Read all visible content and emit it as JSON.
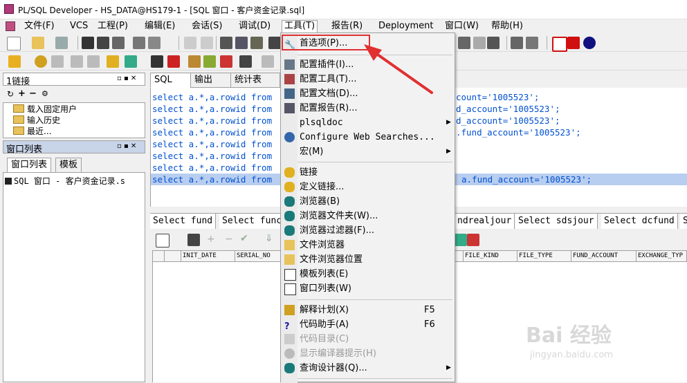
{
  "window": {
    "title": "PL/SQL Developer - HS_DATA@HS179-1 - [SQL 窗口 - 客户资金记录.sql]"
  },
  "menubar": [
    "文件(F)",
    "VCS",
    "工程(P)",
    "编辑(E)",
    "会话(S)",
    "调试(D)",
    "工具(T)",
    "报告(R)",
    "Deployment",
    "窗口(W)",
    "帮助(H)"
  ],
  "connections_panel": {
    "title": "1链接",
    "items": [
      "载入固定用户",
      "输入历史",
      "最近..."
    ]
  },
  "window_list_panel": {
    "title": "窗口列表",
    "tabs": [
      "窗口列表",
      "模板"
    ],
    "item": "SQL 窗口 - 客户资金记录.s"
  },
  "editor_tabs": [
    "SQL",
    "输出",
    "统计表"
  ],
  "code": {
    "prefix": "select a.*,a.rowid from",
    "tails": [
      "count='1005523';",
      "d_account='1005523';",
      "d_account='1005523';",
      ".fund_account='1005523';",
      "",
      "",
      "",
      "a.fund_account='1005523';"
    ]
  },
  "result_tabs": [
    "Select fund",
    "Select func",
    "ndrealjour",
    "Select sdsjour",
    "Select dcfund",
    "S"
  ],
  "grid_columns": [
    "INIT_DATE",
    "SERIAL_NO",
    "FILE_KIND",
    "FILE_TYPE",
    "FUND_ACCOUNT",
    "EXCHANGE_TYP"
  ],
  "tools_menu": [
    {
      "label": "首选项(P)...",
      "icon": "wrench-icon"
    },
    {
      "sep": true
    },
    {
      "label": "配置插件(I)...",
      "icon": "plugin-config-icon"
    },
    {
      "label": "配置工具(T)...",
      "icon": "tools-config-icon"
    },
    {
      "label": "配置文档(D)...",
      "icon": "doc-config-icon"
    },
    {
      "label": "配置报告(R)...",
      "icon": "report-config-icon"
    },
    {
      "label": "plsqldoc",
      "submenu": true
    },
    {
      "label": "Configure Web Searches...",
      "icon": "web-search-icon"
    },
    {
      "label": "宏(M)",
      "submenu": true
    },
    {
      "sep": true
    },
    {
      "label": "链接",
      "icon": "db-link-icon"
    },
    {
      "label": "定义链接...",
      "icon": "db-define-icon"
    },
    {
      "label": "浏览器(B)",
      "icon": "browser-icon"
    },
    {
      "label": "浏览器文件夹(W)...",
      "icon": "browser-folder-icon"
    },
    {
      "label": "浏览器过滤器(F)...",
      "icon": "browser-filter-icon"
    },
    {
      "label": "文件浏览器",
      "icon": "file-browser-icon"
    },
    {
      "label": "文件浏览器位置",
      "icon": "file-browser-location-icon"
    },
    {
      "label": "模板列表(E)",
      "icon": "template-list-icon"
    },
    {
      "label": "窗口列表(W)",
      "icon": "window-list-icon"
    },
    {
      "sep": true
    },
    {
      "label": "解释计划(X)",
      "shortcut": "F5",
      "icon": "explain-plan-icon"
    },
    {
      "label": "代码助手(A)",
      "shortcut": "F6",
      "icon": "code-assistant-icon"
    },
    {
      "label": "代码目录(C)",
      "disabled": true,
      "icon": "code-contents-icon"
    },
    {
      "label": "显示编译器提示(H)",
      "disabled": true,
      "icon": "compiler-hints-icon"
    },
    {
      "label": "查询设计器(Q)...",
      "submenu": true,
      "icon": "query-designer-icon"
    }
  ],
  "watermark": {
    "brand": "Bai 经验",
    "url": "jingyan.baidu.com"
  }
}
